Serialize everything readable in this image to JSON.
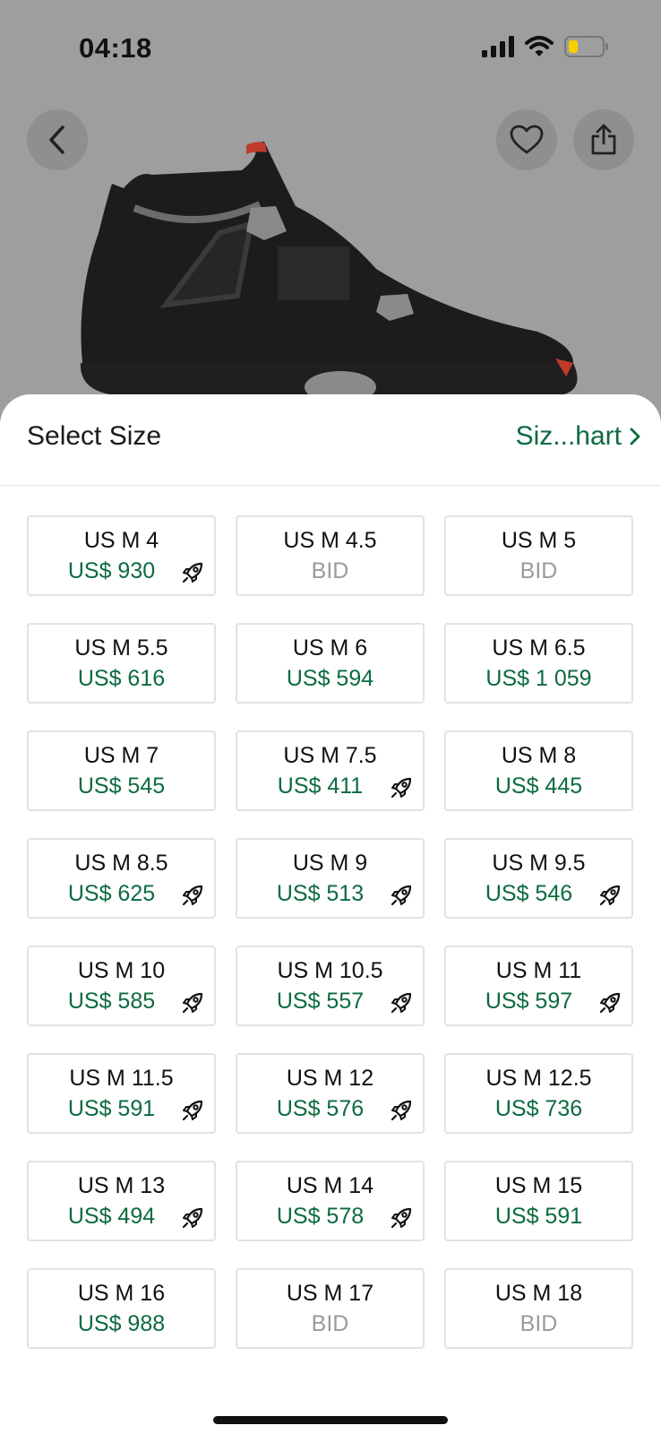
{
  "status_bar": {
    "time": "04:18"
  },
  "header": {
    "title": "Select Size",
    "size_chart_label": "Siz...hart"
  },
  "sizes": [
    {
      "label": "US M 4",
      "price": "US$ 930",
      "bid": false,
      "rocket": true
    },
    {
      "label": "US M 4.5",
      "price": "BID",
      "bid": true,
      "rocket": false
    },
    {
      "label": "US M 5",
      "price": "BID",
      "bid": true,
      "rocket": false
    },
    {
      "label": "US M 5.5",
      "price": "US$ 616",
      "bid": false,
      "rocket": false
    },
    {
      "label": "US M 6",
      "price": "US$ 594",
      "bid": false,
      "rocket": false
    },
    {
      "label": "US M 6.5",
      "price": "US$ 1 059",
      "bid": false,
      "rocket": false
    },
    {
      "label": "US M 7",
      "price": "US$ 545",
      "bid": false,
      "rocket": false
    },
    {
      "label": "US M 7.5",
      "price": "US$ 411",
      "bid": false,
      "rocket": true
    },
    {
      "label": "US M 8",
      "price": "US$ 445",
      "bid": false,
      "rocket": false
    },
    {
      "label": "US M 8.5",
      "price": "US$ 625",
      "bid": false,
      "rocket": true
    },
    {
      "label": "US M 9",
      "price": "US$ 513",
      "bid": false,
      "rocket": true
    },
    {
      "label": "US M 9.5",
      "price": "US$ 546",
      "bid": false,
      "rocket": true
    },
    {
      "label": "US M 10",
      "price": "US$ 585",
      "bid": false,
      "rocket": true
    },
    {
      "label": "US M 10.5",
      "price": "US$ 557",
      "bid": false,
      "rocket": true
    },
    {
      "label": "US M 11",
      "price": "US$ 597",
      "bid": false,
      "rocket": true
    },
    {
      "label": "US M 11.5",
      "price": "US$ 591",
      "bid": false,
      "rocket": true
    },
    {
      "label": "US M 12",
      "price": "US$ 576",
      "bid": false,
      "rocket": true
    },
    {
      "label": "US M 12.5",
      "price": "US$ 736",
      "bid": false,
      "rocket": false
    },
    {
      "label": "US M 13",
      "price": "US$ 494",
      "bid": false,
      "rocket": true
    },
    {
      "label": "US M 14",
      "price": "US$ 578",
      "bid": false,
      "rocket": true
    },
    {
      "label": "US M 15",
      "price": "US$ 591",
      "bid": false,
      "rocket": false
    },
    {
      "label": "US M 16",
      "price": "US$ 988",
      "bid": false,
      "rocket": false
    },
    {
      "label": "US M 17",
      "price": "BID",
      "bid": true,
      "rocket": false
    },
    {
      "label": "US M 18",
      "price": "BID",
      "bid": true,
      "rocket": false
    }
  ],
  "icons": {
    "back": "chevron-left-icon",
    "favorite": "heart-icon",
    "share": "share-icon",
    "express": "rocket-icon",
    "chart_link": "chevron-right-icon"
  },
  "colors": {
    "price_green": "#0b6b3f",
    "bid_gray": "#9a9a9a",
    "overlay_gray": "#9e9e9e"
  }
}
